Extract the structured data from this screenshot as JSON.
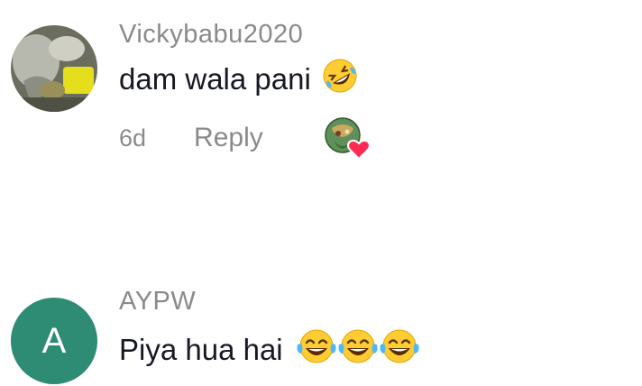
{
  "comments": [
    {
      "username": "Vickybabu2020",
      "text": "dam wala pani",
      "emoji": [
        "rolling-on-floor-laughing"
      ],
      "time": "6d",
      "reply_label": "Reply",
      "creator_liked": true
    },
    {
      "username": "AYPW",
      "avatar_letter": "A",
      "avatar_color": "#2e8b74",
      "text": "Piya hua hai",
      "emoji": [
        "face-with-tears-of-joy",
        "face-with-tears-of-joy",
        "face-with-tears-of-joy"
      ]
    }
  ],
  "colors": {
    "username": "#8a8a8a",
    "text": "#161823",
    "heart": "#fe2c55"
  }
}
